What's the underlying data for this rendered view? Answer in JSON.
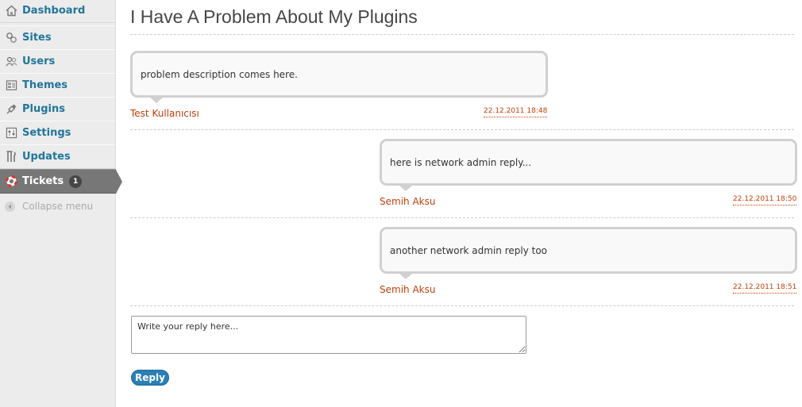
{
  "sidebar": {
    "items": [
      {
        "label": "Dashboard",
        "icon": "home-icon"
      },
      {
        "label": "Sites",
        "icon": "sites-icon"
      },
      {
        "label": "Users",
        "icon": "users-icon"
      },
      {
        "label": "Themes",
        "icon": "themes-icon"
      },
      {
        "label": "Plugins",
        "icon": "plugins-icon"
      },
      {
        "label": "Settings",
        "icon": "settings-icon"
      },
      {
        "label": "Updates",
        "icon": "updates-icon"
      },
      {
        "label": "Tickets",
        "icon": "tickets-icon",
        "badge": "1",
        "active": true
      }
    ],
    "collapse_label": "Collapse menu"
  },
  "page": {
    "title": "I Have A Problem About My Plugins"
  },
  "messages": [
    {
      "text": "problem description comes here.",
      "author": "Test Kullanıcısı",
      "date": "22.12.2011 18:48"
    },
    {
      "text": "here is network admin reply...",
      "author": "Semih Aksu",
      "date": "22.12.2011 18:50"
    },
    {
      "text": "another network admin reply too",
      "author": "Semih Aksu",
      "date": "22.12.2011 18:51"
    }
  ],
  "reply_form": {
    "placeholder": "Write your reply here...",
    "button_label": "Reply"
  },
  "colors": {
    "link": "#21759b",
    "author": "#c0400c",
    "active_menu": "#777777",
    "reply_button": "#2980b5"
  }
}
